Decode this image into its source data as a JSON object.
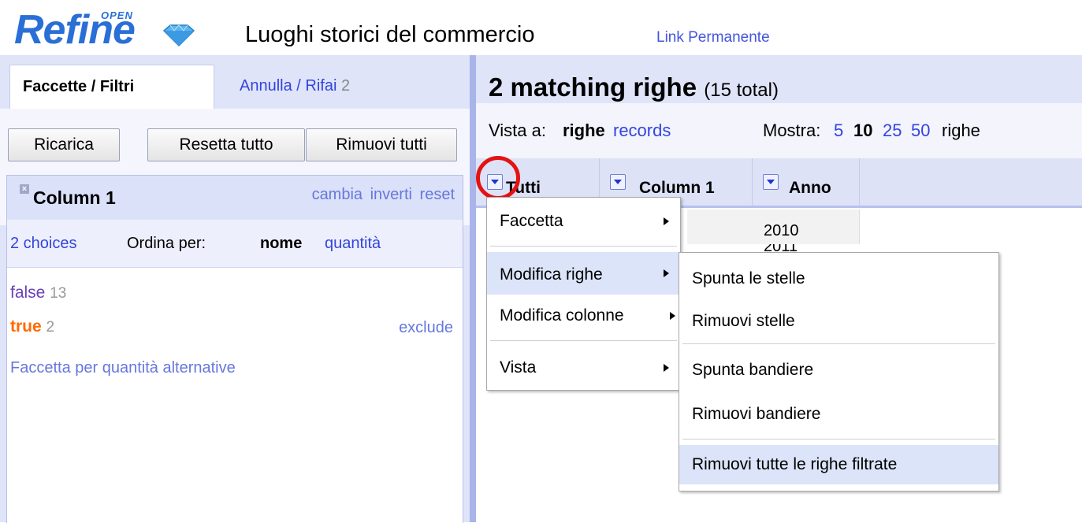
{
  "header": {
    "logo_word": "Refine",
    "logo_open": "OPEN",
    "project_title": "Luoghi storici del commercio",
    "permalink": "Link Permanente"
  },
  "left_panel": {
    "tabs": [
      {
        "label": "Faccette / Filtri"
      },
      {
        "label": "Annulla / Rifai",
        "count": "2"
      }
    ],
    "buttons": {
      "reload": "Ricarica",
      "reset_all": "Resetta tutto",
      "remove_all": "Rimuovi tutti"
    },
    "facet": {
      "close_icon": "close-icon",
      "name": "Column 1",
      "actions": [
        "cambia",
        "inverti",
        "reset"
      ],
      "choices_summary": "2 choices",
      "sort_label": "Ordina per:",
      "sort_name": "nome",
      "sort_count": "quantità",
      "choices": [
        {
          "label": "false",
          "count": "13"
        },
        {
          "label": "true",
          "count": "2"
        }
      ],
      "exclude": "exclude",
      "alternative_counts": "Faccetta per quantità alternative"
    }
  },
  "right_panel": {
    "summary": {
      "matching": "2 matching righe",
      "total": "(15 total)"
    },
    "view": {
      "view_label": "Vista a:",
      "rows": "righe",
      "records": "records",
      "show_label": "Mostra:",
      "page_sizes": [
        "5",
        "10",
        "25",
        "50"
      ],
      "selected_size": "10",
      "rows_suffix": "righe"
    },
    "columns": [
      "Tutti",
      "Column 1",
      "Anno"
    ],
    "cells": [
      "2010",
      "2011"
    ]
  },
  "menu": {
    "items": [
      "Faccetta",
      "Modifica righe",
      "Modifica colonne",
      "Vista"
    ],
    "submenu": [
      "Spunta le stelle",
      "Rimuovi stelle",
      "Spunta bandiere",
      "Rimuovi bandiere",
      "Rimuovi tutte le righe filtrate"
    ]
  },
  "colors": {
    "accent": "#3344dd",
    "panel_bg": "#dfe4f9",
    "highlight_ring": "#e41212",
    "true_choice": "#ff6a00"
  }
}
